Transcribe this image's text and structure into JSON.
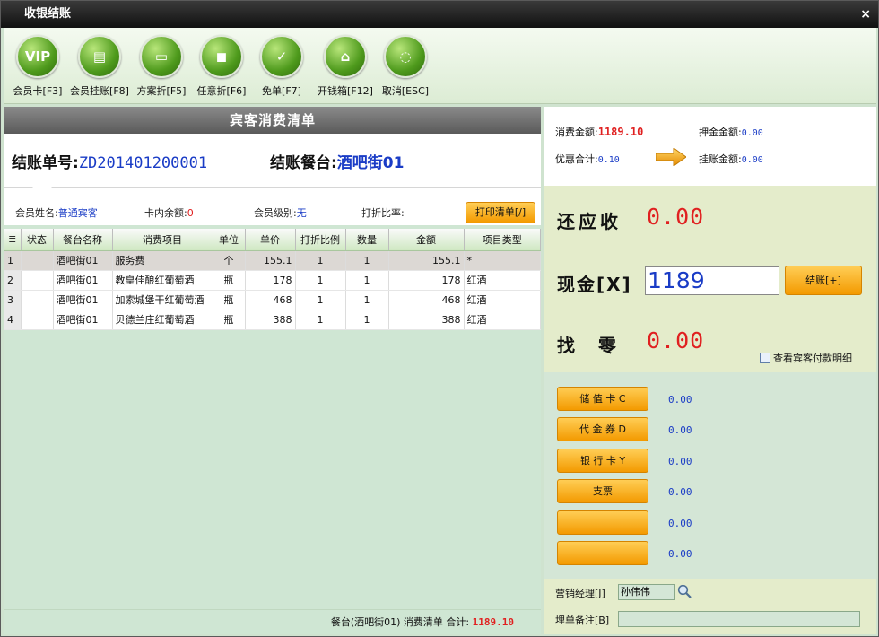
{
  "window": {
    "title": "收银结账",
    "close_label": "×"
  },
  "toolbar": [
    {
      "label": "会员卡[F3]",
      "icon": "vip-icon",
      "glyph": "VIP"
    },
    {
      "label": "会员挂账[F8]",
      "icon": "member-credit-icon",
      "glyph": "▤"
    },
    {
      "label": "方案折[F5]",
      "icon": "plan-discount-icon",
      "glyph": "▭"
    },
    {
      "label": "任意折[F6]",
      "icon": "custom-discount-icon",
      "glyph": "◼"
    },
    {
      "label": "免单[F7]",
      "icon": "free-order-icon",
      "glyph": "✓"
    },
    {
      "label": "开钱箱[F12]",
      "icon": "cash-drawer-icon",
      "glyph": "⌂"
    },
    {
      "label": "取消[ESC]",
      "icon": "cancel-icon",
      "glyph": "◌"
    }
  ],
  "bill": {
    "header": "宾客消费清单",
    "order_label": "结账单号:",
    "order_no": "ZD201401200001",
    "table_label": "结账餐台:",
    "table_name": "酒吧街01"
  },
  "member": {
    "name_label": "会员姓名:",
    "name_value": "普通宾客",
    "balance_label": "卡内余额:",
    "balance_value": "0",
    "level_label": "会员级别:",
    "level_value": "无",
    "discount_label": "打折比率:",
    "print_button": "打印清单[/]"
  },
  "grid": {
    "columns": [
      "状态",
      "餐台名称",
      "消费项目",
      "单位",
      "单价",
      "打折比例",
      "数量",
      "金额",
      "项目类型"
    ],
    "rows": [
      {
        "idx": "1",
        "status": "",
        "table": "酒吧街01",
        "item": "服务费",
        "unit": "个",
        "price": "155.1",
        "discount": "1",
        "qty": "1",
        "amount": "155.1",
        "type": "*"
      },
      {
        "idx": "2",
        "status": "",
        "table": "酒吧街01",
        "item": "教皇佳酿红葡萄酒",
        "unit": "瓶",
        "price": "178",
        "discount": "1",
        "qty": "1",
        "amount": "178",
        "type": "红酒"
      },
      {
        "idx": "3",
        "status": "",
        "table": "酒吧街01",
        "item": "加索城堡干红葡萄酒",
        "unit": "瓶",
        "price": "468",
        "discount": "1",
        "qty": "1",
        "amount": "468",
        "type": "红酒"
      },
      {
        "idx": "4",
        "status": "",
        "table": "酒吧街01",
        "item": "贝德兰庄红葡萄酒",
        "unit": "瓶",
        "price": "388",
        "discount": "1",
        "qty": "1",
        "amount": "388",
        "type": "红酒"
      }
    ]
  },
  "footer": {
    "text": "餐台(酒吧街01) 消费清单 合计:",
    "total": "1189.10"
  },
  "summary": {
    "consume_label": "消费金额:",
    "consume_value": "1189.10",
    "deposit_label": "押金金额:",
    "deposit_value": "0.00",
    "discount_label": "优惠合计:",
    "discount_value": "0.10",
    "credit_label": "挂账金额:",
    "credit_value": "0.00"
  },
  "payment": {
    "due_label": "还应收",
    "due_value": "0.00",
    "cash_label": "现金[X]",
    "cash_value": "1189",
    "settle_button": "结账[+]",
    "change_label": "找  零",
    "change_value": "0.00",
    "detail_checkbox": "查看宾客付款明细"
  },
  "methods": [
    {
      "label": "储 值 卡 C",
      "value": "0.00"
    },
    {
      "label": "代 金 券 D",
      "value": "0.00"
    },
    {
      "label": "银 行 卡 Y",
      "value": "0.00"
    },
    {
      "label": "支票",
      "value": "0.00"
    },
    {
      "label": "",
      "value": "0.00"
    },
    {
      "label": "",
      "value": "0.00"
    }
  ],
  "bottom": {
    "manager_label": "营销经理[J]",
    "manager_value": "孙伟伟",
    "note_label": "埋单备注[B]",
    "note_value": ""
  },
  "colors": {
    "accent_orange": "#f39a00",
    "amount_red": "#e02020",
    "value_blue": "#1a3cc6"
  }
}
